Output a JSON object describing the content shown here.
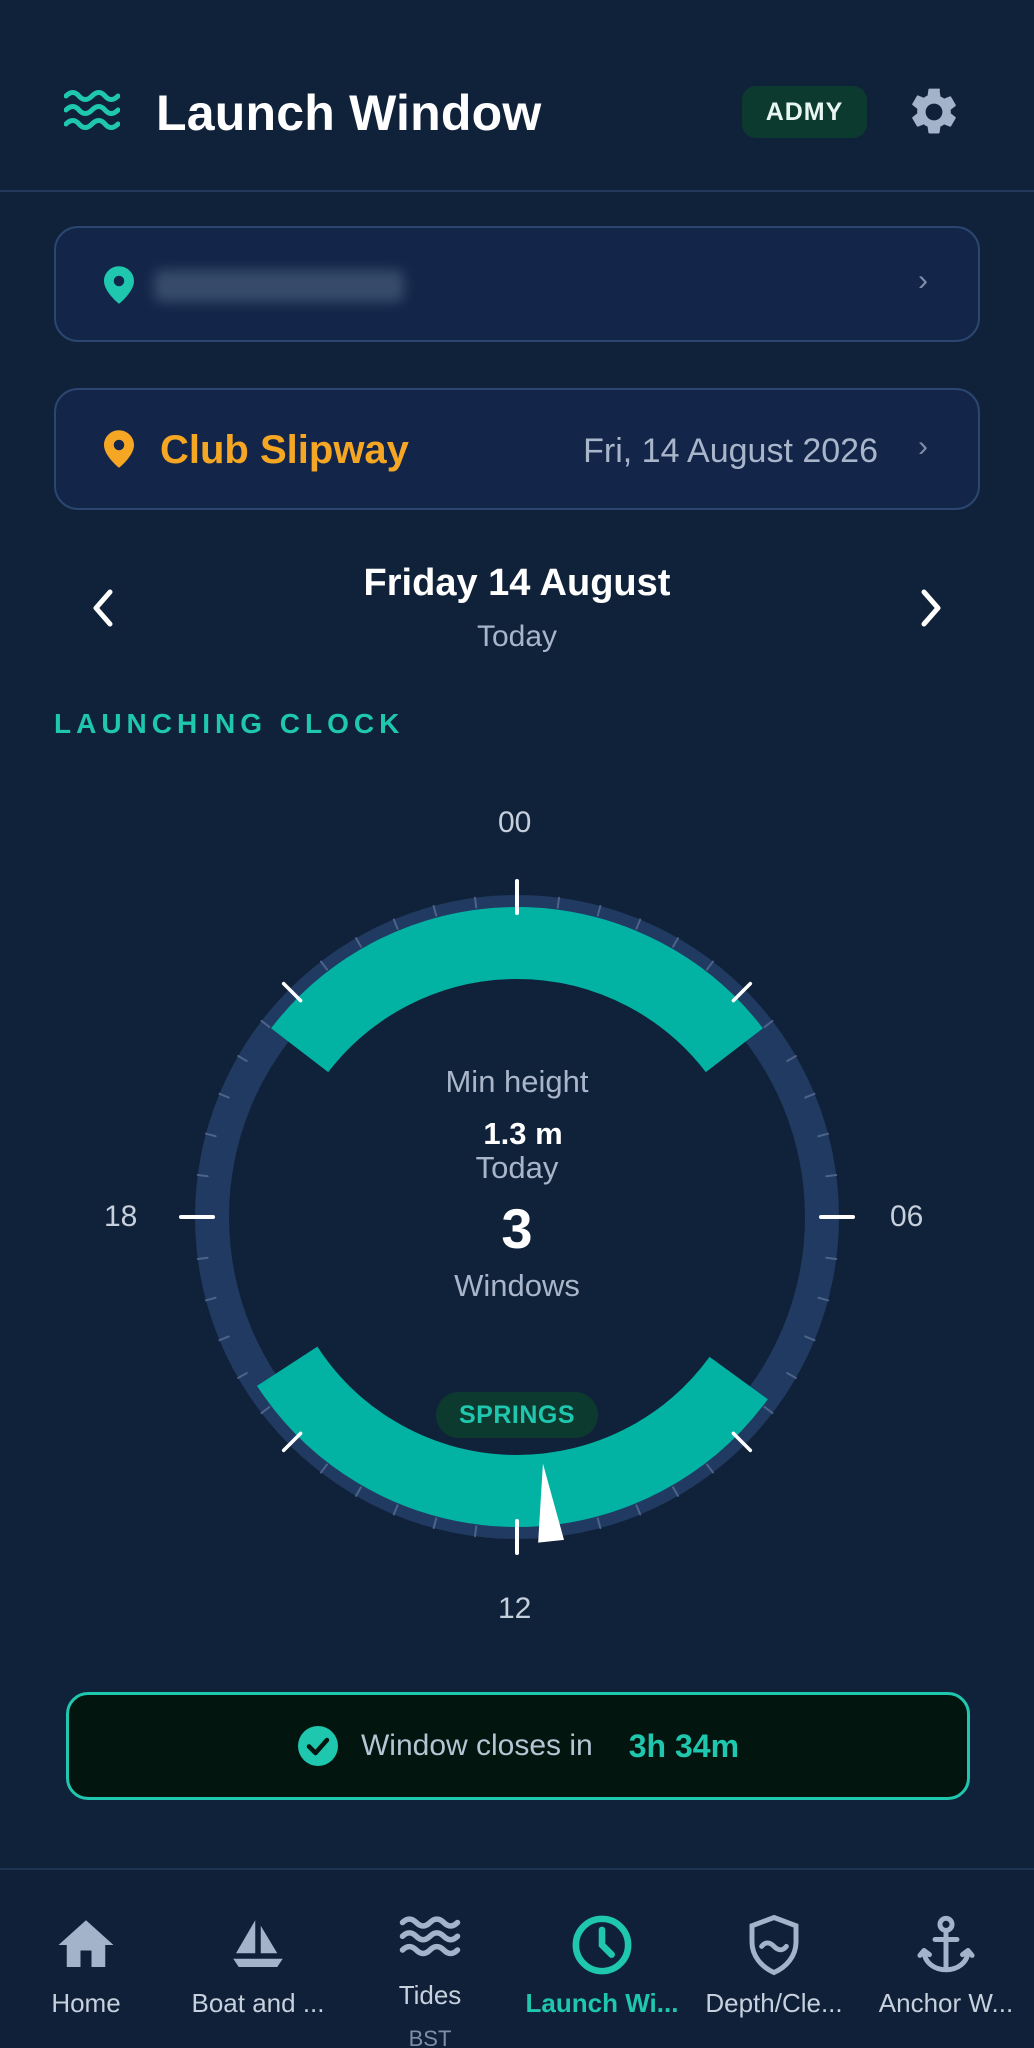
{
  "header": {
    "title": "Launch Window",
    "source_badge": "ADMY",
    "icons": [
      "waves-icon",
      "gear-icon"
    ]
  },
  "location": {
    "harbour_chevron": "›",
    "slipway_name": "Club Slipway",
    "date": "Fri, 14 August 2026",
    "chevron": "›"
  },
  "day_nav": {
    "title": "Friday 14 August",
    "subtitle": "Today"
  },
  "section_label": "LAUNCHING CLOCK",
  "clock": {
    "hour_labels": {
      "top": "00",
      "right": "06",
      "bottom": "12",
      "left": "18"
    },
    "min_height_label": "Min height",
    "min_height_value": "1.3 m",
    "day_label": "Today",
    "window_count": "3",
    "window_label": "Windows",
    "tide_badge": "SPRINGS",
    "windows_hours": [
      [
        20.5,
        3.5
      ],
      [
        8.4,
        15.8
      ]
    ],
    "current_hour": 11.6,
    "colors": {
      "window": "#02b3a4",
      "ring": "#213a61",
      "face": "#10223a"
    }
  },
  "status": {
    "text": "Window closes in",
    "time": "3h 34m"
  },
  "bottom_nav": [
    {
      "label": "Home",
      "icon": "home-icon",
      "active": false
    },
    {
      "label": "Boat and ...",
      "icon": "sailboat-icon",
      "active": false
    },
    {
      "label": "Tides",
      "sub": "BST",
      "icon": "tides-icon",
      "active": false
    },
    {
      "label": "Launch Wi...",
      "icon": "clock-icon",
      "active": true
    },
    {
      "label": "Depth/Cle...",
      "icon": "depth-shield-icon",
      "active": false
    },
    {
      "label": "Anchor W...",
      "icon": "anchor-icon",
      "active": false
    }
  ]
}
